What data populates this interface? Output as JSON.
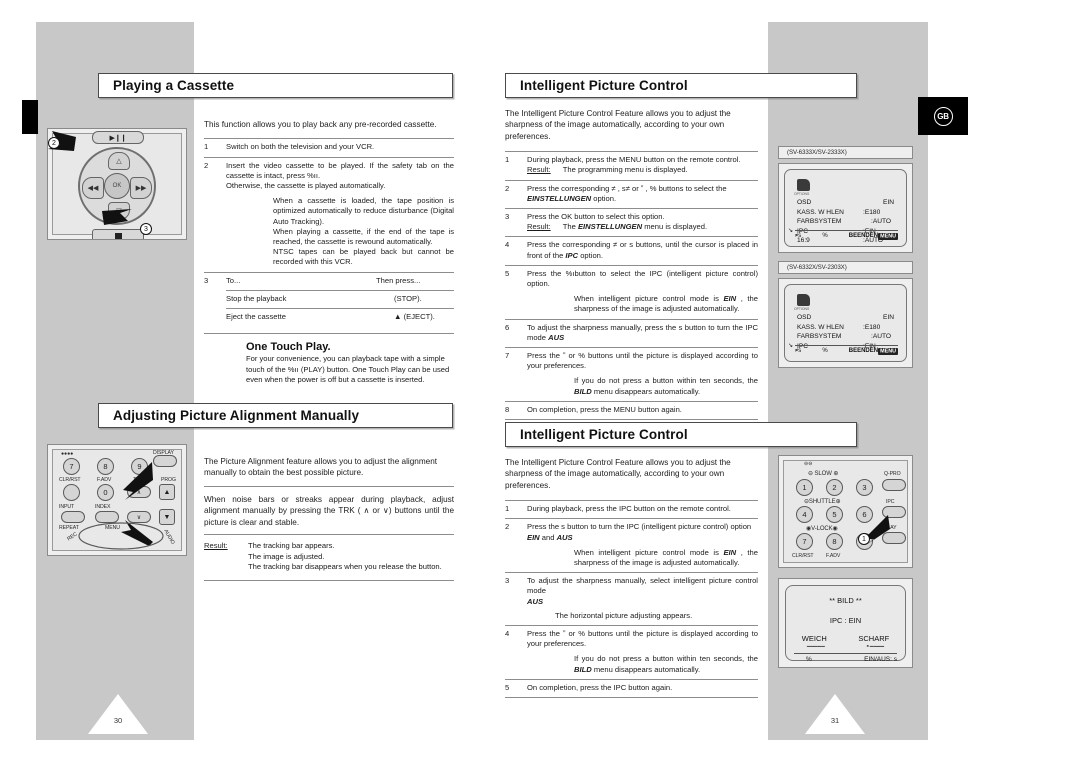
{
  "document": {
    "type": "vcr-user-manual-page-spread",
    "language_badge": "GB",
    "page_numbers": {
      "left": "30",
      "right": "31"
    }
  },
  "left_page": {
    "section1": {
      "heading": "Playing a Cassette",
      "intro": "This function allows you to play back any pre-recorded cassette.",
      "steps": [
        {
          "num": "1",
          "text": "Switch on both the television and your VCR."
        },
        {
          "num": "2",
          "text": "Insert the video cassette to be played. If the safety tab on the cassette is intact, press %ıı.",
          "line2": "Otherwise, the cassette is played automatically.",
          "notes": [
            "When a cassette is loaded, the tape position is optimized automatically to reduce disturbance (Digital Auto Tracking).",
            "When playing a cassette, if the end of the tape is reached, the cassette is rewound automatically.",
            "NTSC tapes can be played back but cannot be recorded with this VCR."
          ]
        },
        {
          "num": "3",
          "table": {
            "headers": [
              "To...",
              "Then press..."
            ],
            "rows": [
              [
                "Stop the playback",
                "(STOP)."
              ],
              [
                "Eject the cassette",
                "▲ (EJECT)."
              ]
            ]
          }
        }
      ],
      "subsection": {
        "title": "One Touch Play.",
        "body": "For your convenience, you can playback tape with a simple touch of the %ıı (PLAY) button. One Touch Play can be used even when the power is off but a cassette is inserted."
      },
      "illustration": {
        "name": "vcr-jog-dial",
        "hub_label": "OK",
        "play_label": "▶❙❙",
        "callouts": [
          "2",
          "3"
        ]
      }
    },
    "section2": {
      "heading": "Adjusting Picture Alignment Manually",
      "intro": "The Picture Alignment feature allows you to adjust the alignment manually to obtain the best possible picture.",
      "paragraph": "When noise bars or streaks appear during playback, adjust alignment manually by pressing the TRK ( ∧ or ∨) buttons until the picture is clear and stable.",
      "result_label": "Result:",
      "results": [
        "The tracking bar appears.",
        "The image is adjusted.",
        "The tracking bar disappears when you release the button."
      ],
      "illustration": {
        "name": "remote-tracking-buttons",
        "buttons": [
          "7",
          "8",
          "9",
          "CLR/RST",
          "F.ADV",
          "0",
          "INPUT",
          "INDEX",
          "REPEAT",
          "TRK",
          "PROG",
          "DISPLAY",
          "MENU",
          "REC",
          "AUDIO"
        ]
      }
    }
  },
  "right_page": {
    "section1": {
      "heading": "Intelligent Picture Control",
      "intro": "The Intelligent Picture Control Feature allows you to adjust the sharpness of the image automatically, according to your own preferences.",
      "steps": [
        {
          "num": "1",
          "text": "During playback, press the MENU button on the remote control.",
          "result_label": "Result:",
          "result": "The programming menu is displayed."
        },
        {
          "num": "2",
          "text_a": "Press the corresponding ≠ , s≠ or ˮ , % buttons to select the ",
          "emphasis": "EINSTELLUNGEN",
          "text_b": " option."
        },
        {
          "num": "3",
          "text": "Press the OK button to select this option.",
          "result_label": "Result:",
          "result_a": "The ",
          "result_em": "EINSTELLUNGEN",
          "result_b": " menu is displayed."
        },
        {
          "num": "4",
          "text_a": "Press the corresponding ≠  or s  buttons, until the cursor is placed in front of the ",
          "emphasis": "IPC",
          "text_b": " option."
        },
        {
          "num": "5",
          "text": "Press the %ıbutton to select the IPC (intelligent picture control) option.",
          "note_a": "When intelligent picture control mode is ",
          "note_em": "EIN",
          "note_b": " , the sharpness of the image is adjusted automatically."
        },
        {
          "num": "6",
          "text_a": "To adjust the sharpness manually, press the s  button to turn the IPC mode ",
          "emphasis": "AUS"
        },
        {
          "num": "7",
          "text": "Press the ˮ  or % buttons until the picture is displayed according to your preferences.",
          "note_a": "If you do not press a button within ten seconds, the ",
          "note_em": "BILD",
          "note_b": " menu disappears automatically."
        },
        {
          "num": "8",
          "text": "On completion, press the MENU button again."
        }
      ],
      "osd_screens": [
        {
          "model_label": "(SV-6333X/SV-2333X)",
          "icon_caption": "OPTIONS",
          "rows": [
            {
              "key": "OSD",
              "value": "EIN",
              "cursor": false
            },
            {
              "key": "KASS. W HLEN",
              "value": ":E180",
              "cursor": false
            },
            {
              "key": "FARBSYSTEM",
              "value": ":AUTO",
              "cursor": false
            },
            {
              "key": "IPC",
              "value": ":EIN",
              "cursor": true
            },
            {
              "key": "16:9",
              "value": ":AUTO",
              "cursor": false
            }
          ],
          "footer_left": "≠s",
          "footer_mid": "%",
          "footer_right": "BEENDEN",
          "footer_key": "MENU"
        },
        {
          "model_label": "(SV-6332X/SV-2303X)",
          "icon_caption": "OPTIONS",
          "rows": [
            {
              "key": "OSD",
              "value": "EIN",
              "cursor": false
            },
            {
              "key": "KASS. W HLEN",
              "value": ":E180",
              "cursor": false
            },
            {
              "key": "FARBSYSTEM",
              "value": ":AUTO",
              "cursor": false
            },
            {
              "key": "IPC",
              "value": ":EIN",
              "cursor": true
            }
          ],
          "footer_left": "≠s",
          "footer_mid": "%",
          "footer_right": "BEENDEN",
          "footer_key": "MENU"
        }
      ]
    },
    "section2": {
      "heading": "Intelligent Picture Control",
      "intro": "The Intelligent Picture Control Feature allows you to adjust the sharpness of the image automatically, according to your own preferences.",
      "steps": [
        {
          "num": "1",
          "text": "During playback, press the IPC button on the remote control."
        },
        {
          "num": "2",
          "text_a": "Press the s  button to turn the IPC (intelligent picture control) option ",
          "emphasis": "EIN",
          "text_mid": " and ",
          "emphasis2": "AUS",
          "note_a": "When intelligent picture control mode is ",
          "note_em": "EIN",
          "note_b": " , the sharpness of the image is adjusted automatically."
        },
        {
          "num": "3",
          "text_a": "To adjust the sharpness manually, select intelligent picture control mode ",
          "emphasis": "AUS",
          "note": "The horizontal picture adjusting appears."
        },
        {
          "num": "4",
          "text": "Press the ˮ  or % buttons until the picture is displayed according to your preferences.",
          "note_a": "If you do not press a button within ten seconds, the ",
          "note_em": "BILD",
          "note_b": " menu disappears automatically."
        },
        {
          "num": "5",
          "text": "On completion, press the IPC button again."
        }
      ],
      "remote_illustration": {
        "name": "remote-ipc-button",
        "labels": [
          "SLOW",
          "SHUTTLE",
          "V-LOCK",
          "Q-PRO",
          "IPC",
          "PLAY",
          "CLR/RST",
          "F.ADV"
        ],
        "number_keys": [
          "1",
          "2",
          "3",
          "4",
          "5",
          "6",
          "7",
          "8",
          "9"
        ],
        "callout": "1"
      },
      "bild_screen": {
        "title": "**  BILD  **",
        "mode_line": "IPC : EIN",
        "left_label": "WEICH",
        "right_label": "SCHARF",
        "footer_left": "%",
        "footer_right": "EIN/AUS: s"
      }
    }
  }
}
